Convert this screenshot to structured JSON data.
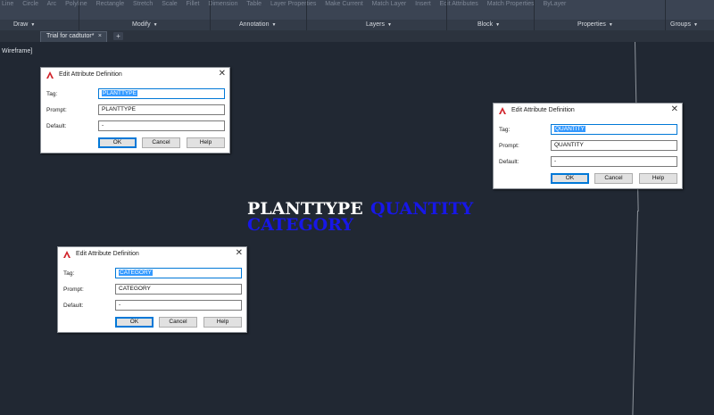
{
  "ribbon": {
    "ghost_text": [
      "Line",
      "Circle",
      "Arc",
      "Polyline",
      "Rectangle",
      "Stretch",
      "Scale",
      "Fillet",
      "Dimension",
      "Table",
      "Layer Properties",
      "Make Current",
      "Match Layer",
      "Insert",
      "Edit Attributes",
      "Match Properties",
      "ByLayer"
    ],
    "panels": [
      {
        "label": "Draw",
        "dropdown": true
      },
      {
        "label": "Modify",
        "dropdown": true
      },
      {
        "label": "Annotation",
        "dropdown": true
      },
      {
        "label": "Layers",
        "dropdown": true
      },
      {
        "label": "Block",
        "dropdown": true
      },
      {
        "label": "Properties",
        "dropdown": true
      },
      {
        "label": "Groups",
        "dropdown": true
      }
    ]
  },
  "tabs": {
    "document": "Trial for cadtutor*",
    "close_glyph": "×",
    "add_glyph": "+"
  },
  "viewport": {
    "label": "Wireframe]",
    "text_white": "PLANTTYPE",
    "text_blue_1": "QUANTITY",
    "text_blue_2": "CATEGORY"
  },
  "colors": {
    "canvas": "#212833",
    "ribbon": "#3b4453",
    "attribute_white": "#ffffff",
    "attribute_blue": "#1717e8",
    "selection": "#3399ff",
    "logo_red": "#d12229"
  },
  "dialog_common": {
    "title": "Edit Attribute Definition",
    "close_glyph": "✕",
    "tag_label": "Tag:",
    "prompt_label": "Prompt:",
    "default_label": "Default:",
    "ok_label": "OK",
    "cancel_label": "Cancel",
    "help_label": "Help",
    "logo_icon": "autocad-logo-icon"
  },
  "dialogs": [
    {
      "tag": "PLANTTYPE",
      "prompt": "PLANTTYPE",
      "default": "-"
    },
    {
      "tag": "QUANTITY",
      "prompt": "QUANTITY",
      "default": "-"
    },
    {
      "tag": "CATEGORY",
      "prompt": "CATEGORY",
      "default": "-"
    }
  ]
}
